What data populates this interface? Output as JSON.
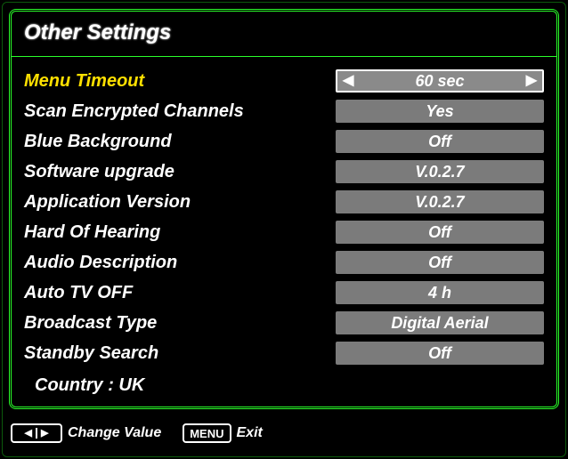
{
  "title": "Other Settings",
  "selectedIndex": 0,
  "settings": [
    {
      "id": "menu-timeout",
      "label": "Menu Timeout",
      "value": "60 sec"
    },
    {
      "id": "scan-encrypted",
      "label": "Scan Encrypted Channels",
      "value": "Yes"
    },
    {
      "id": "blue-background",
      "label": "Blue Background",
      "value": "Off"
    },
    {
      "id": "software-upgrade",
      "label": "Software upgrade",
      "value": "V.0.2.7"
    },
    {
      "id": "application-version",
      "label": "Application Version",
      "value": "V.0.2.7"
    },
    {
      "id": "hard-of-hearing",
      "label": "Hard Of Hearing",
      "value": "Off"
    },
    {
      "id": "audio-description",
      "label": "Audio Description",
      "value": "Off"
    },
    {
      "id": "auto-tv-off",
      "label": "Auto TV OFF",
      "value": "4 h"
    },
    {
      "id": "broadcast-type",
      "label": "Broadcast Type",
      "value": "Digital Aerial"
    },
    {
      "id": "standby-search",
      "label": "Standby Search",
      "value": "Off"
    }
  ],
  "countryLabel": "Country : UK",
  "hints": {
    "changeValue": "Change Value",
    "exitKey": "MENU",
    "exitLabel": "Exit"
  },
  "glyphs": {
    "left": "◀",
    "right": "▶",
    "triLeft": "◀",
    "triRight": "▶"
  }
}
